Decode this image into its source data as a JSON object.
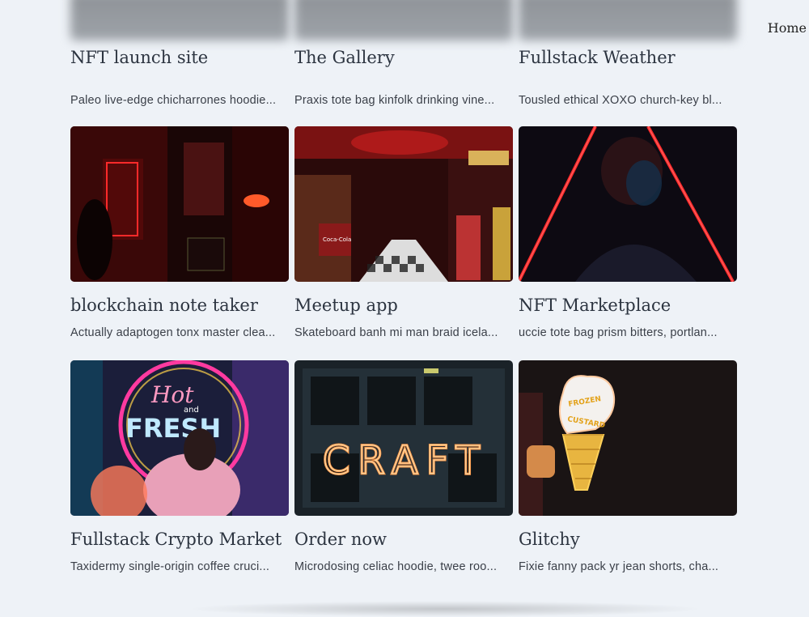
{
  "nav": {
    "home_label": "Home"
  },
  "cards": [
    {
      "title": "NFT launch site",
      "desc": "Paleo live-edge chicharrones hoodie..."
    },
    {
      "title": "The Gallery",
      "desc": "Praxis tote bag kinfolk drinking vine..."
    },
    {
      "title": "Fullstack Weather",
      "desc": "Tousled ethical XOXO church-key bl..."
    },
    {
      "title": "blockchain note taker",
      "desc": "Actually adaptogen tonx master clea..."
    },
    {
      "title": "Meetup app",
      "desc": "Skateboard banh mi man braid icela..."
    },
    {
      "title": "NFT Marketplace",
      "desc": "uccie tote bag prism bitters, portlan..."
    },
    {
      "title": "Fullstack Crypto Market",
      "desc": "Taxidermy single-origin coffee cruci..."
    },
    {
      "title": "Order now",
      "desc": "Microdosing celiac hoodie, twee roo..."
    },
    {
      "title": "Glitchy",
      "desc": "Fixie fanny pack yr jean shorts, cha..."
    }
  ],
  "neon_text": {
    "craft": "CRAFT",
    "hot": "Hot",
    "and": "and",
    "fresh": "FRESH",
    "frozen": "FROZEN",
    "custard": "CUSTARD",
    "coca": "Coca-Cola"
  },
  "colors": {
    "background": "#eef2f7",
    "title": "#2c3440",
    "neon_red": "#ff2a2a",
    "neon_orange": "#ff8a3c"
  }
}
